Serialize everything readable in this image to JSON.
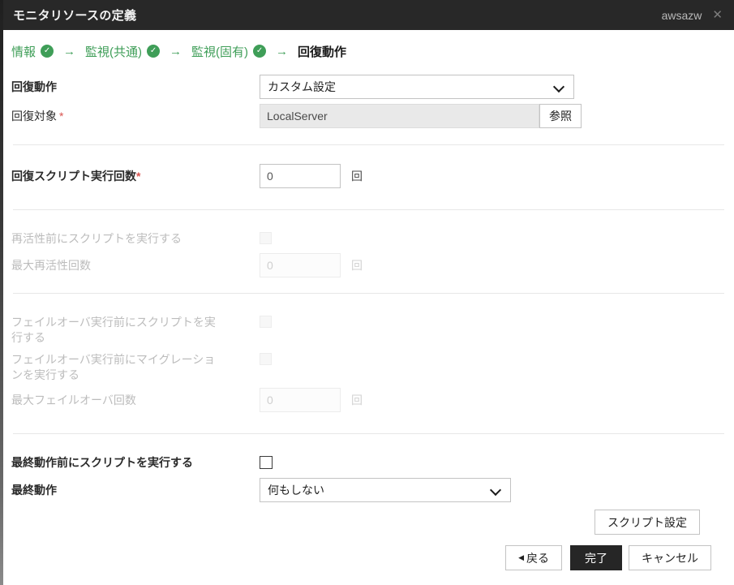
{
  "colors": {
    "accent_green": "#3f9e58",
    "titlebar_bg": "#282828",
    "required_red": "#d9534f",
    "primary_button_bg": "#262626",
    "readonly_bg": "#e9e9e9"
  },
  "titlebar": {
    "title": "モニタリソースの定義",
    "resource_name": "awsazw",
    "close_glyph": "✕"
  },
  "wizard": {
    "arrow_glyph": "→",
    "check_glyph": "✓",
    "steps": [
      {
        "label": "情報",
        "done": true
      },
      {
        "label": "監視(共通)",
        "done": true
      },
      {
        "label": "監視(固有)",
        "done": true
      },
      {
        "label": "回復動作",
        "done": false,
        "current": true
      }
    ]
  },
  "form": {
    "recovery_action": {
      "label": "回復動作",
      "value": "カスタム設定"
    },
    "recovery_target": {
      "label": "回復対象",
      "required": "*",
      "value": "LocalServer",
      "browse_label": "参照"
    },
    "recovery_script_count": {
      "label": "回復スクリプト実行回数",
      "required": "*",
      "value": "0",
      "unit": "回"
    },
    "reactivation": {
      "exec_script_label": "再活性前にスクリプトを実行する",
      "max_count": {
        "label": "最大再活性回数",
        "value": "0",
        "unit": "回"
      }
    },
    "failover": {
      "exec_script_label": "フェイルオーバ実行前にスクリプトを実行する",
      "exec_migration_label": "フェイルオーバ実行前にマイグレーションを実行する",
      "max_count": {
        "label": "最大フェイルオーバ回数",
        "value": "0",
        "unit": "回"
      }
    },
    "final": {
      "exec_script_label": "最終動作前にスクリプトを実行する",
      "action": {
        "label": "最終動作",
        "value": "何もしない"
      }
    }
  },
  "buttons": {
    "script_settings": "スクリプト設定",
    "back_glyph": "◀",
    "back": "戻る",
    "finish": "完了",
    "cancel": "キャンセル"
  }
}
